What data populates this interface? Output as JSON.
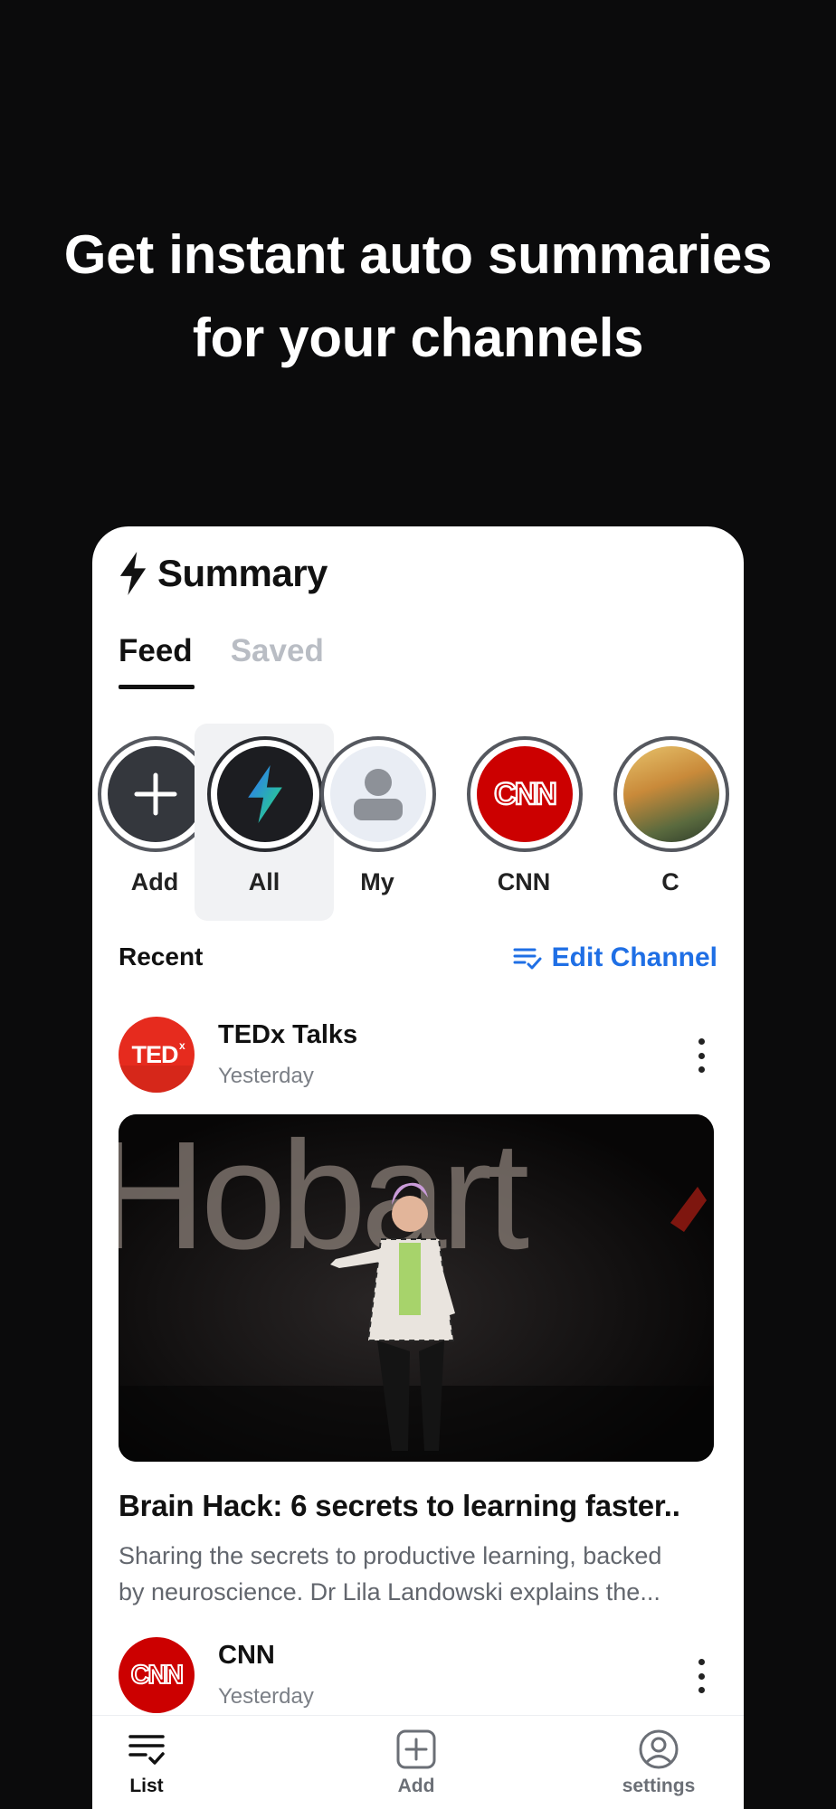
{
  "headline": {
    "line1": "Get instant auto summaries",
    "line2": "for your channels"
  },
  "app": {
    "name": "Summary",
    "tabs": [
      {
        "label": "Feed",
        "active": true
      },
      {
        "label": "Saved",
        "active": false
      }
    ],
    "channels": [
      {
        "label": "Add",
        "icon": "plus-icon"
      },
      {
        "label": "All",
        "icon": "lightning-bolt-icon",
        "selected": true
      },
      {
        "label": "My",
        "icon": "person-icon"
      },
      {
        "label": "CNN",
        "icon": "cnn-logo"
      },
      {
        "label": "C",
        "icon": "channel-thumbnail"
      }
    ],
    "section_label": "Recent",
    "edit_label": "Edit Channel",
    "posts": [
      {
        "channel": "TEDx Talks",
        "logo_text": "TEDx",
        "time": "Yesterday",
        "thumbnail_text": "Hobart",
        "title": "Brain Hack: 6 secrets to learning faster..",
        "desc_line1": "Sharing the secrets to productive learning, backed",
        "desc_line2": "by neuroscience. Dr Lila Landowski explains the..."
      },
      {
        "channel": "CNN",
        "logo_text": "CNN",
        "time": "Yesterday"
      }
    ],
    "nav": [
      {
        "label": "List",
        "icon": "list-check-icon"
      },
      {
        "label": "Add",
        "icon": "plus-square-icon"
      },
      {
        "label": "settings",
        "icon": "user-circle-icon"
      }
    ]
  },
  "colors": {
    "background": "#0b0b0c",
    "accent_blue": "#1f6fe5",
    "ted_red": "#e62b1e",
    "cnn_red": "#cc0000"
  }
}
